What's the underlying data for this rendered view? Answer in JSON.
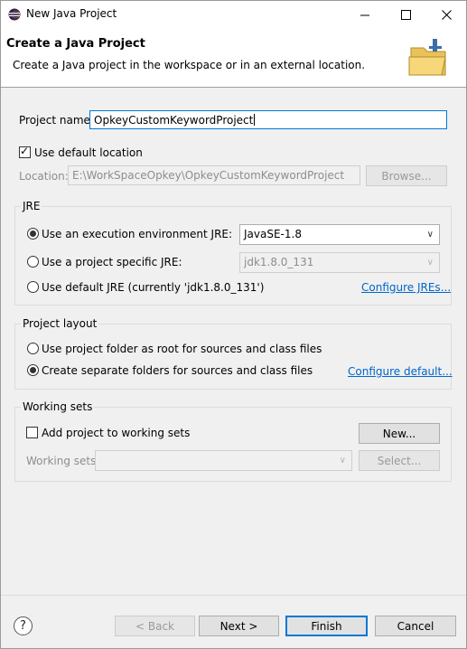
{
  "window": {
    "title": "New Java Project"
  },
  "header": {
    "title": "Create a Java Project",
    "description": "Create a Java project in the workspace or in an external location."
  },
  "project": {
    "name_label": "Project name:",
    "name_value": "OpkeyCustomKeywordProject",
    "use_default_location_label": "Use default location",
    "use_default_location_checked": true,
    "location_label": "Location:",
    "location_value": "E:\\WorkSpaceOpkey\\OpkeyCustomKeywordProject",
    "browse_label": "Browse..."
  },
  "jre": {
    "group_title": "JRE",
    "exec_env_label": "Use an execution environment JRE:",
    "exec_env_value": "JavaSE-1.8",
    "project_specific_label": "Use a project specific JRE:",
    "project_specific_value": "jdk1.8.0_131",
    "default_jre_label": "Use default JRE (currently 'jdk1.8.0_131')",
    "configure_link": "Configure JREs..."
  },
  "layout": {
    "group_title": "Project layout",
    "option_root_label": "Use project folder as root for sources and class files",
    "option_separate_label": "Create separate folders for sources and class files",
    "configure_link": "Configure default..."
  },
  "working_sets": {
    "group_title": "Working sets",
    "add_label": "Add project to working sets",
    "new_label": "New...",
    "sets_label": "Working sets:",
    "select_label": "Select..."
  },
  "footer": {
    "help_label": "?",
    "back_label": "< Back",
    "next_label": "Next >",
    "finish_label": "Finish",
    "cancel_label": "Cancel"
  },
  "colors": {
    "link": "#0066cc",
    "focus": "#0078d7",
    "folder": "#f6d77a"
  },
  "icons": {
    "app": "eclipse-icon",
    "minimize": "minimize-icon",
    "maximize": "maximize-icon",
    "close": "close-icon",
    "banner": "open-folder-icon",
    "dropdown": "chevron-down-icon",
    "check": "checkmark-icon",
    "help": "help-icon"
  }
}
